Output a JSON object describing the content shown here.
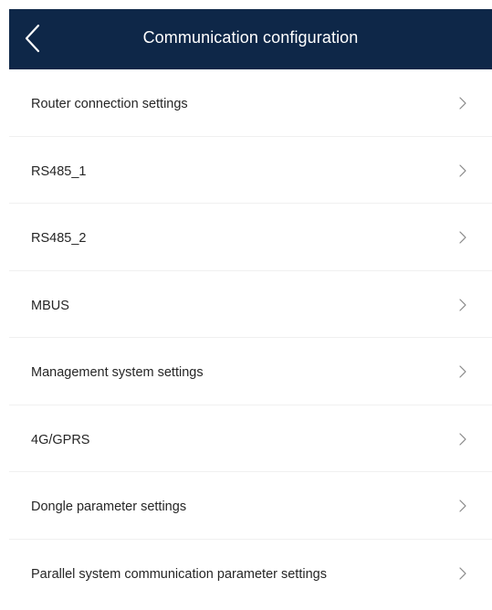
{
  "header": {
    "title": "Communication configuration",
    "back_icon": "chevron-left-icon",
    "background_color": "#0e2748"
  },
  "menu": {
    "items": [
      {
        "label": "Router connection settings",
        "icon": "chevron-right-icon"
      },
      {
        "label": "RS485_1",
        "icon": "chevron-right-icon"
      },
      {
        "label": "RS485_2",
        "icon": "chevron-right-icon"
      },
      {
        "label": "MBUS",
        "icon": "chevron-right-icon"
      },
      {
        "label": "Management system settings",
        "icon": "chevron-right-icon"
      },
      {
        "label": "4G/GPRS",
        "icon": "chevron-right-icon"
      },
      {
        "label": "Dongle parameter settings",
        "icon": "chevron-right-icon"
      },
      {
        "label": "Parallel system communication parameter settings",
        "icon": "chevron-right-icon"
      }
    ]
  }
}
